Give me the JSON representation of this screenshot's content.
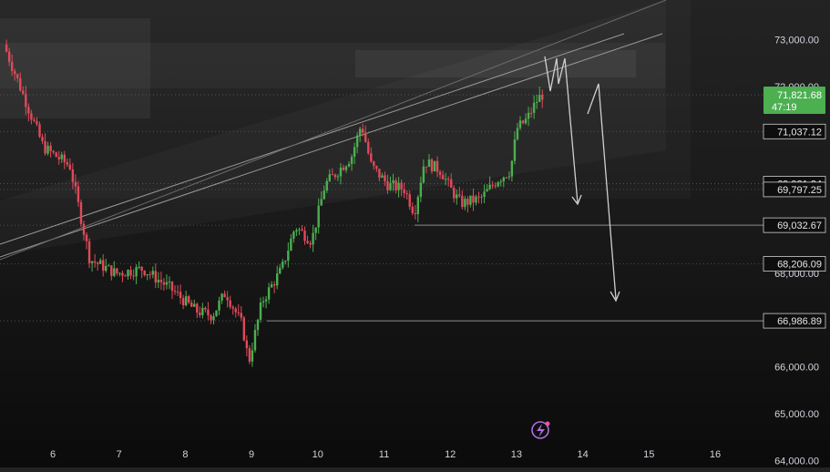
{
  "chart_data": {
    "type": "candlestick",
    "title": "",
    "xlabel": "",
    "ylabel": "",
    "x_ticks": [
      "6",
      "7",
      "8",
      "9",
      "10",
      "11",
      "12",
      "13",
      "14",
      "15",
      "16"
    ],
    "y_ticks": [
      "64,000.00",
      "65,000.00",
      "66,000.00",
      "68,000.00",
      "72,000.00",
      "73,000.00"
    ],
    "ylim": [
      63850,
      73850
    ],
    "current_price": {
      "label": "71,821.68",
      "value": 71821.68,
      "countdown": "47:19",
      "color": "#4caf50"
    },
    "price_levels": [
      {
        "label": "71,037.12",
        "value": 71037.12
      },
      {
        "label": "69,921.24",
        "value": 69921.24
      },
      {
        "label": "69,797.25",
        "value": 69797.25
      },
      {
        "label": "69,032.67",
        "value": 69032.67
      },
      {
        "label": "68,206.09",
        "value": 68206.09
      },
      {
        "label": "66,986.89",
        "value": 66986.89
      }
    ],
    "series": [
      {
        "points": [
          {
            "day": 5.3,
            "price": 72900
          },
          {
            "day": 5.6,
            "price": 71800
          },
          {
            "day": 5.9,
            "price": 70700
          },
          {
            "day": 6.3,
            "price": 70300
          },
          {
            "day": 6.6,
            "price": 68300
          },
          {
            "day": 7.0,
            "price": 68000
          },
          {
            "day": 7.4,
            "price": 68100
          },
          {
            "day": 7.8,
            "price": 67700
          },
          {
            "day": 8.2,
            "price": 67200
          },
          {
            "day": 8.45,
            "price": 67100
          },
          {
            "day": 8.65,
            "price": 67600
          },
          {
            "day": 8.9,
            "price": 66900
          },
          {
            "day": 9.0,
            "price": 66100
          },
          {
            "day": 9.2,
            "price": 67400
          },
          {
            "day": 9.5,
            "price": 68100
          },
          {
            "day": 9.7,
            "price": 69000
          },
          {
            "day": 9.95,
            "price": 68700
          },
          {
            "day": 10.15,
            "price": 69900
          },
          {
            "day": 10.35,
            "price": 70200
          },
          {
            "day": 10.55,
            "price": 70500
          },
          {
            "day": 10.7,
            "price": 71200
          },
          {
            "day": 10.85,
            "price": 70300
          },
          {
            "day": 11.1,
            "price": 69900
          },
          {
            "day": 11.35,
            "price": 69800
          },
          {
            "day": 11.5,
            "price": 69300
          },
          {
            "day": 11.65,
            "price": 70400
          },
          {
            "day": 11.9,
            "price": 70200
          },
          {
            "day": 12.05,
            "price": 69800
          },
          {
            "day": 12.2,
            "price": 69500
          },
          {
            "day": 12.5,
            "price": 69600
          },
          {
            "day": 12.75,
            "price": 70000
          },
          {
            "day": 12.95,
            "price": 70200
          },
          {
            "day": 13.05,
            "price": 71100
          },
          {
            "day": 13.2,
            "price": 71300
          },
          {
            "day": 13.35,
            "price": 71700
          },
          {
            "day": 13.42,
            "price": 71821
          }
        ]
      }
    ]
  }
}
